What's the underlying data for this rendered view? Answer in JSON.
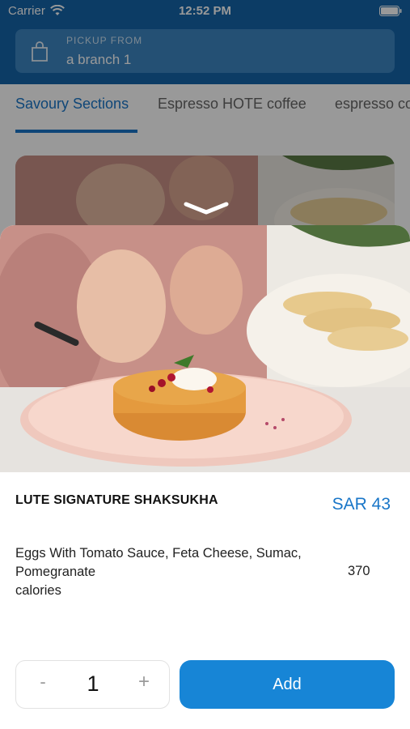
{
  "status_bar": {
    "carrier": "Carrier",
    "time": "12:52 PM"
  },
  "pickup": {
    "label": "PICKUP FROM",
    "value": "a branch 1"
  },
  "tabs": [
    {
      "label": "Savoury Sections",
      "active": true
    },
    {
      "label": "Espresso HOTE coffee",
      "active": false
    },
    {
      "label": "espresso co",
      "active": false
    }
  ],
  "item": {
    "title": "LUTE SIGNATURE SHAKSUKHA",
    "price": "SAR 43",
    "description_line1": "Eggs With Tomato Sauce, Feta Cheese, Sumac,",
    "description_line2": "Pomegranate",
    "description_line3": "calories",
    "calories": "370"
  },
  "quantity": {
    "minus": "-",
    "value": "1",
    "plus": "+"
  },
  "add_button": {
    "label": "Add"
  },
  "colors": {
    "brand_blue": "#1565a8",
    "accent_blue": "#1976c8",
    "button_blue": "#1785d6"
  },
  "icons": [
    "wifi-icon",
    "battery-icon",
    "bag-icon",
    "chevron-down-icon"
  ]
}
